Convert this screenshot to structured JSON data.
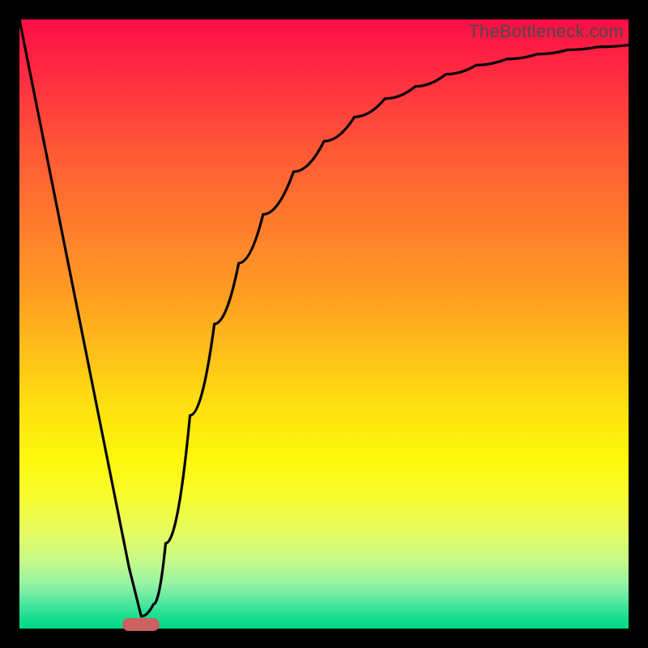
{
  "watermark": "TheBottleneck.com",
  "chart_data": {
    "type": "line",
    "title": "",
    "xlabel": "",
    "ylabel": "",
    "xlim": [
      0,
      100
    ],
    "ylim": [
      0,
      100
    ],
    "grid": false,
    "legend": false,
    "background": "heatmap-gradient",
    "series": [
      {
        "name": "bottleneck-curve",
        "x": [
          0,
          4,
          8,
          12,
          16,
          18,
          20,
          22,
          24,
          28,
          32,
          36,
          40,
          45,
          50,
          55,
          60,
          65,
          70,
          75,
          80,
          85,
          90,
          95,
          100
        ],
        "y": [
          100,
          80,
          60,
          40,
          20,
          10,
          2,
          4,
          14,
          35,
          50,
          60,
          68,
          75,
          80,
          84,
          87,
          89,
          91,
          92.5,
          93.5,
          94.3,
          95,
          95.5,
          95.8
        ]
      }
    ],
    "marker": {
      "x": 20,
      "y": 0.7,
      "label": "optimal-point"
    },
    "gradient_stops": [
      {
        "pct": 0,
        "color": "#ff0d47"
      },
      {
        "pct": 50,
        "color": "#ffc418"
      },
      {
        "pct": 75,
        "color": "#fef70c"
      },
      {
        "pct": 100,
        "color": "#00d985"
      }
    ]
  }
}
